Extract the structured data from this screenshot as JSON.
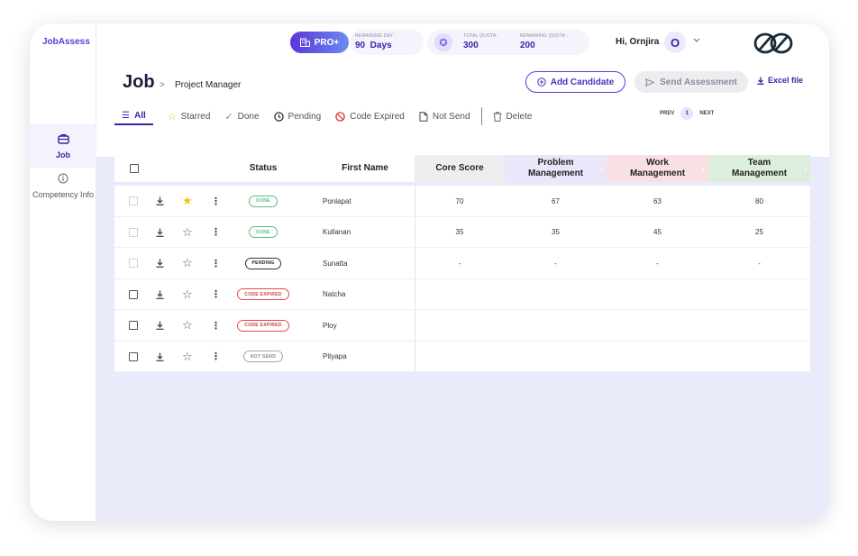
{
  "app": {
    "logo": "JobAssess"
  },
  "sidebar": {
    "items": [
      {
        "label": "Job",
        "icon": "briefcase-icon",
        "active": true
      },
      {
        "label": "Competency Info",
        "icon": "info-icon",
        "active": false
      }
    ]
  },
  "header": {
    "plan_label": "PRO+",
    "remaining_day_caption": "REMAINING DAY :",
    "remaining_day_value": "90  Days",
    "total_quota_caption": "TOTAL QUOTA :",
    "total_quota_value": "300",
    "remaining_quota_caption": "REMAINING QUOTA :",
    "remaining_quota_value": "200",
    "greeting": "Hi, Ornjira",
    "avatar_initial": "O"
  },
  "page": {
    "title": "Job",
    "breadcrumb_sep": ">",
    "breadcrumb": "Project Manager",
    "add_candidate": "Add Candidate",
    "send_assessment": "Send Assessment",
    "excel": "Excel file"
  },
  "filters": {
    "all": "All",
    "starred": "Starred",
    "done": "Done",
    "pending": "Pending",
    "code_expired": "Code Expired",
    "not_send": "Not Send",
    "delete": "Delete"
  },
  "pager": {
    "prev": "PREV",
    "page": "1",
    "next": "NEXT"
  },
  "table": {
    "headers": {
      "status": "Status",
      "first_name": "First Name",
      "core": "Core Score",
      "problem": "Problem Management",
      "work": "Work Management",
      "team": "Team Management"
    },
    "colors": {
      "core": "#eeeef1",
      "problem": "#ece6fb",
      "work": "#f9e1e3",
      "team": "#dcefdc"
    },
    "rows": [
      {
        "starred": true,
        "status": "DONE",
        "status_type": "done",
        "name": "Ponlapat",
        "core": "70",
        "problem": "67",
        "work": "63",
        "team": "80"
      },
      {
        "starred": false,
        "status": "DONE",
        "status_type": "done",
        "name": "Kullanan",
        "core": "35",
        "problem": "35",
        "work": "45",
        "team": "25"
      },
      {
        "starred": false,
        "status": "PENDING",
        "status_type": "pending",
        "name": "Sunatta",
        "core": "-",
        "problem": "-",
        "work": "-",
        "team": "-"
      },
      {
        "starred": false,
        "status": "CODE EXPIRED",
        "status_type": "expired",
        "name": "Natcha",
        "core": "",
        "problem": "",
        "work": "",
        "team": ""
      },
      {
        "starred": false,
        "status": "CODE EXPIRED",
        "status_type": "expired",
        "name": "Ploy",
        "core": "",
        "problem": "",
        "work": "",
        "team": ""
      },
      {
        "starred": false,
        "status": "NOT SEND",
        "status_type": "notsend",
        "name": "Pityapa",
        "core": "",
        "problem": "",
        "work": "",
        "team": ""
      }
    ]
  }
}
